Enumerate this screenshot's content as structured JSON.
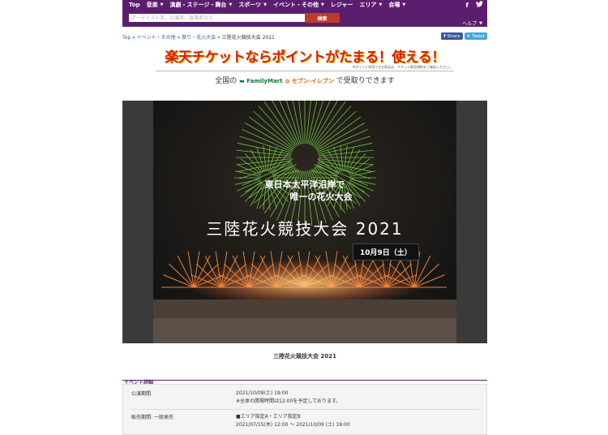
{
  "nav": {
    "items": [
      {
        "label": "Top",
        "caret": false
      },
      {
        "label": "音楽",
        "caret": true
      },
      {
        "label": "演劇・ステージ・舞台",
        "caret": true
      },
      {
        "label": "スポーツ",
        "caret": true
      },
      {
        "label": "イベント・その他",
        "caret": true
      },
      {
        "label": "レジャー",
        "caret": false
      },
      {
        "label": "エリア",
        "caret": true
      },
      {
        "label": "会場",
        "caret": true
      }
    ],
    "icons": {
      "facebook": "f",
      "twitter": "t"
    },
    "search_placeholder": "アーティスト名、公演名、会場名など",
    "search_button": "検索",
    "help": "ヘルプ"
  },
  "breadcrumb": {
    "items": [
      "Top",
      "イベント・その他",
      "祭り・花火大会"
    ],
    "sep": " » ",
    "current": "三陸花火競技大会 2021"
  },
  "share": {
    "facebook": "Share",
    "twitter": "Tweet"
  },
  "banner": {
    "main": "楽天チケットならポイントがたまる！使える！",
    "sub": "※ポイント利用できる商品は、チケット販売規約をご確認ください。",
    "pickup_prefix": "全国の",
    "familymart": "FamilyMart",
    "seven": "セブン-イレブン",
    "pickup_suffix": "で受取りできます"
  },
  "hero": {
    "tagline_1": "東日本太平洋沿岸で",
    "tagline_2": "唯一の花火大会",
    "title": "三陸花火競技大会 2021",
    "date": "10月9日（土）"
  },
  "caption": "三陸花火競技大会 2021",
  "section_title": "イベント詳細",
  "details": [
    {
      "label": "公演期間",
      "lines": [
        "2021/10/09(土) 19:00",
        "※全体の開場時間は12:00を予定しております。"
      ]
    },
    {
      "label": "販売期間: 一般発売",
      "lines": [
        "■エリア指定A・エリア指定B",
        "2021/07/15(木) 12:00 〜 2021/10/09 (土) 19:00"
      ]
    }
  ],
  "colors": {
    "nav": "#5b1e6e",
    "search_button": "#c0392b",
    "accent_red": "#d6201a"
  }
}
